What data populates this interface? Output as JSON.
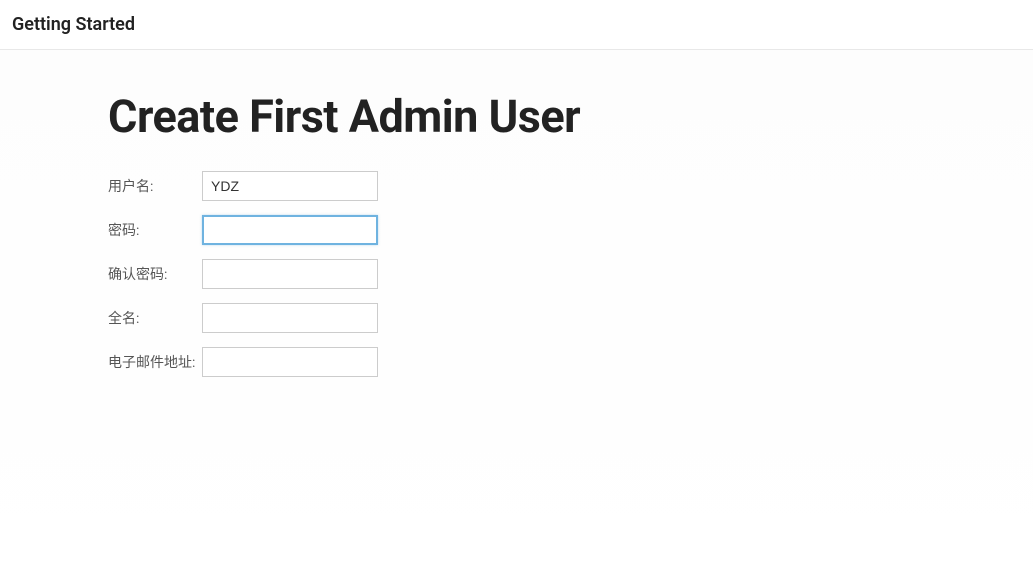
{
  "header": {
    "title": "Getting Started"
  },
  "main": {
    "title": "Create First Admin User"
  },
  "form": {
    "username": {
      "label": "用户名:",
      "value": "YDZ"
    },
    "password": {
      "label": "密码:",
      "value": ""
    },
    "confirm_password": {
      "label": "确认密码:",
      "value": ""
    },
    "full_name": {
      "label": "全名:",
      "value": ""
    },
    "email": {
      "label": "电子邮件地址:",
      "value": ""
    }
  }
}
